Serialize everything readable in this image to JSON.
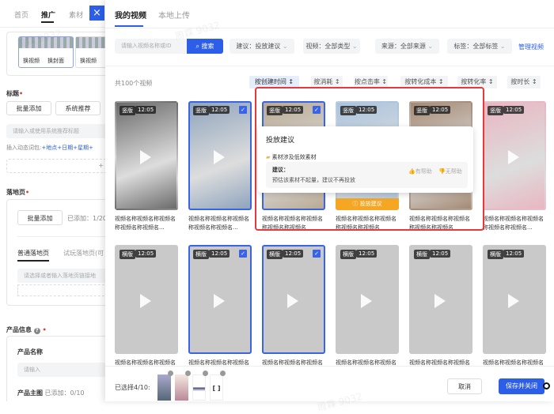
{
  "left": {
    "tabs": [
      "首页",
      "推广",
      "素材"
    ],
    "active_tab": "推广",
    "close_icon": "×",
    "thumb_actions": [
      "换视频",
      "换封面",
      "换视频"
    ],
    "title_label": "标题",
    "batch_add": "批量添加",
    "system_recommend": "系统推荐",
    "title_placeholder": "请输入或使用系统推荐标题",
    "dynamic_words_label": "插入动态词包:",
    "dynamic_words": "+地点+日期+星期+",
    "plus": "+",
    "landing_label": "落地页",
    "landing_batch_add": "批量添加",
    "landing_added": "已添加：1/20",
    "landing_tabs": [
      "普通落地页",
      "试玩落地页(可"
    ],
    "landing_placeholder": "请选择或者输入落地页链接地",
    "product_label": "产品信息",
    "product_name_label": "产品名称",
    "product_name_placeholder": "请输入",
    "product_image_label": "产品主图",
    "product_image_added": "已添加：0/10"
  },
  "drawer": {
    "tabs": [
      "我的视频",
      "本地上传"
    ],
    "active_tab": "我的视频",
    "search_placeholder": "请输入视频名称或ID",
    "search_button": "搜索",
    "filters": [
      "建议：投放建议",
      "视频：全部类型",
      "来源：全部来源",
      "标签：全部标签"
    ],
    "manage_link": "管理视频",
    "total": "共100个视频",
    "sorts": [
      "按创建时间 ↕",
      "按消耗 ↕",
      "按点击率 ↕",
      "按转化成本 ↕",
      "按转化率 ↕",
      "按时长 ↕"
    ],
    "active_sort": "按创建时间",
    "cards_row1": [
      {
        "type": "竖版",
        "duration": "12:05",
        "title": "视频名称视频名称视频名称视频名称视频名...",
        "selected": false,
        "thumb": "#6b6b6b"
      },
      {
        "type": "竖版",
        "duration": "12:05",
        "title": "视频名称视频名称视频名称视频名称视频名...",
        "selected": true,
        "thumb": "#8fa4bd"
      },
      {
        "type": "竖版",
        "duration": "12:05",
        "title": "视频名称视频名称视频名称视频名称视频名",
        "selected": true,
        "thumb": "#b9a992"
      },
      {
        "type": "竖版",
        "duration": "12:05",
        "title": "视频名称视频名称视频名称视频名称视频名",
        "selected": false,
        "thumb": "#a9c3de"
      },
      {
        "type": "竖版",
        "duration": "12:05",
        "title": "视频名称视频名称视频名称视频名称视频名",
        "selected": false,
        "thumb": "#a58a74"
      },
      {
        "type": "竖版",
        "duration": "12:05",
        "title": "视频名称视频名称视频名称视频名称视频名...",
        "selected": false,
        "thumb": "#e9b6c1"
      }
    ],
    "cards_row2": [
      {
        "type": "横版",
        "duration": "12:05",
        "title": "视频名称视频名称视频名",
        "selected": false,
        "thumb": "#c9c9c9"
      },
      {
        "type": "横版",
        "duration": "12:05",
        "title": "视频名称视频名称视频名",
        "selected": true,
        "thumb": "#c9c9c9"
      },
      {
        "type": "横版",
        "duration": "12:05",
        "title": "视频名称视频名称视频名",
        "selected": true,
        "thumb": "#c9c9c9"
      },
      {
        "type": "横版",
        "duration": "12:05",
        "title": "视频名称视频名称视频名",
        "selected": false,
        "thumb": "#c9c9c9"
      },
      {
        "type": "横版",
        "duration": "12:05",
        "title": "视频名称视频名称视频名",
        "selected": false,
        "thumb": "#c9c9c9"
      },
      {
        "type": "横版",
        "duration": "12:05",
        "title": "视频名称视频名称视频名",
        "selected": false,
        "thumb": "#c9c9c9"
      }
    ],
    "advice_bar": "投放建议",
    "popover": {
      "title": "投放建议",
      "issue": "素材涉及低效素材",
      "advice_label": "建议：",
      "advice_text": "预估该素材不起量，建议不再投放",
      "helpful": "有帮助",
      "unhelpful": "无帮助"
    },
    "footer": {
      "selected_label": "已选择4/10:",
      "cancel": "取消",
      "save": "保存并关闭"
    }
  },
  "watermark": "周霖 9032",
  "colors": {
    "primary": "#2c5ee8",
    "highlight_box": "#e8383d",
    "advice": "#f5a623"
  }
}
